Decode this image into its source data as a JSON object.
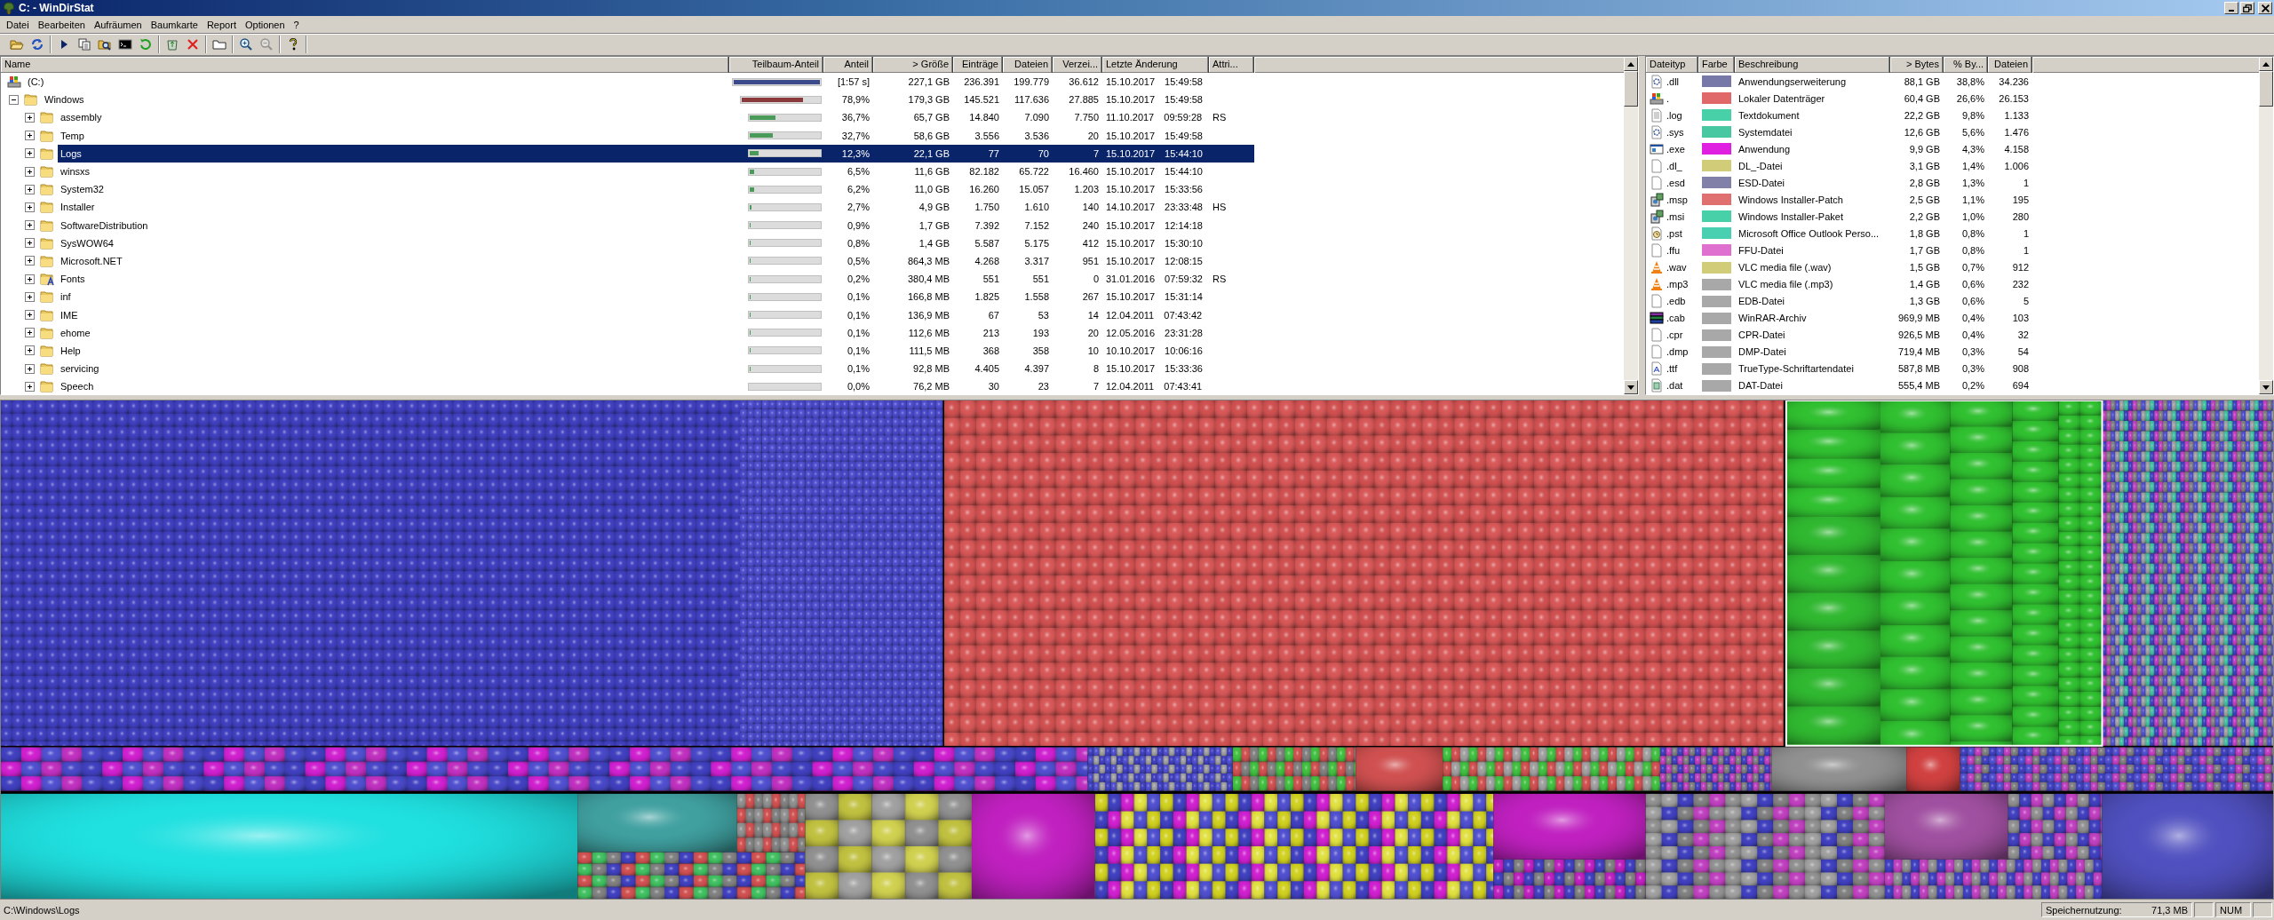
{
  "window": {
    "title": "C: - WinDirStat"
  },
  "menu": [
    "Datei",
    "Bearbeiten",
    "Aufräumen",
    "Baumkarte",
    "Report",
    "Optionen",
    "?"
  ],
  "toolbar": {
    "groups": [
      {
        "buttons": [
          {
            "kind": "open",
            "disabled": false
          },
          {
            "kind": "rescan",
            "disabled": false
          }
        ]
      },
      {
        "buttons": [
          {
            "kind": "play",
            "disabled": false
          },
          {
            "kind": "copy",
            "disabled": false
          },
          {
            "kind": "explorer",
            "disabled": false
          },
          {
            "kind": "terminal",
            "disabled": false
          },
          {
            "kind": "refresh",
            "disabled": false
          }
        ]
      },
      {
        "buttons": [
          {
            "kind": "recycle",
            "disabled": false
          },
          {
            "kind": "delete",
            "disabled": false
          }
        ]
      },
      {
        "buttons": [
          {
            "kind": "properties",
            "disabled": false
          }
        ]
      },
      {
        "buttons": [
          {
            "kind": "zoom_in",
            "disabled": false
          },
          {
            "kind": "zoom_out",
            "disabled": true
          }
        ]
      },
      {
        "buttons": [
          {
            "kind": "help",
            "disabled": false
          }
        ]
      }
    ]
  },
  "directory_tree": {
    "columns": [
      "Name",
      "Teilbaum-Anteil",
      "Anteil",
      "> Größe",
      "Einträge",
      "Dateien",
      "Verzei...",
      "Letzte Änderung",
      "Attri..."
    ],
    "rows": [
      {
        "name": "(C:)",
        "kind": "drive",
        "selected": false,
        "level": 1,
        "share": "[1:57 s]",
        "size": "227,1 GB",
        "entries": "236.391",
        "files": "199.779",
        "folders": "36.612",
        "modified": "15.10.2017 15:49:58",
        "children": [
          {
            "name": "Windows",
            "kind": "folder",
            "expanded": true,
            "selected": false,
            "level": 0.789,
            "share": "78,9%",
            "size": "179,3 GB",
            "entries": "145.521",
            "files": "117.636",
            "folders": "27.885",
            "modified": "15.10.2017 15:49:58",
            "children": [
              {
                "name": "assembly",
                "kind": "folder",
                "expanded": false,
                "selected": false,
                "level": 0.367,
                "share": "36,7%",
                "size": "65,7 GB",
                "entries": "14.840",
                "files": "7.090",
                "folders": "7.750",
                "modified": "11.10.2017 09:59:28",
                "attributes": "RS"
              },
              {
                "name": "Temp",
                "kind": "folder",
                "expanded": false,
                "selected": false,
                "level": 0.327,
                "share": "32,7%",
                "size": "58,6 GB",
                "entries": "3.556",
                "files": "3.536",
                "folders": "20",
                "modified": "15.10.2017 15:49:58"
              },
              {
                "name": "Logs",
                "kind": "folder",
                "expanded": false,
                "selected": true,
                "level": 0.123,
                "share": "12,3%",
                "size": "22,1 GB",
                "entries": "77",
                "files": "70",
                "folders": "7",
                "modified": "15.10.2017 15:44:10"
              },
              {
                "name": "winsxs",
                "kind": "folder",
                "expanded": false,
                "selected": false,
                "level": 0.065,
                "share": "6,5%",
                "size": "11,6 GB",
                "entries": "82.182",
                "files": "65.722",
                "folders": "16.460",
                "modified": "15.10.2017 15:44:10"
              },
              {
                "name": "System32",
                "kind": "folder",
                "expanded": false,
                "selected": false,
                "level": 0.062,
                "share": "6,2%",
                "size": "11,0 GB",
                "entries": "16.260",
                "files": "15.057",
                "folders": "1.203",
                "modified": "15.10.2017 15:33:56"
              },
              {
                "name": "Installer",
                "kind": "folder",
                "expanded": false,
                "selected": false,
                "level": 0.027,
                "share": "2,7%",
                "size": "4,9 GB",
                "entries": "1.750",
                "files": "1.610",
                "folders": "140",
                "modified": "14.10.2017 23:33:48",
                "attributes": "HS"
              },
              {
                "name": "SoftwareDistribution",
                "kind": "folder",
                "expanded": false,
                "selected": false,
                "level": 0.009,
                "share": "0,9%",
                "size": "1,7 GB",
                "entries": "7.392",
                "files": "7.152",
                "folders": "240",
                "modified": "15.10.2017 12:14:18"
              },
              {
                "name": "SysWOW64",
                "kind": "folder",
                "expanded": false,
                "selected": false,
                "level": 0.008,
                "share": "0,8%",
                "size": "1,4 GB",
                "entries": "5.587",
                "files": "5.175",
                "folders": "412",
                "modified": "15.10.2017 15:30:10"
              },
              {
                "name": "Microsoft.NET",
                "kind": "folder",
                "expanded": false,
                "selected": false,
                "level": 0.005,
                "share": "0,5%",
                "size": "864,3 MB",
                "entries": "4.268",
                "files": "3.317",
                "folders": "951",
                "modified": "15.10.2017 12:08:15"
              },
              {
                "name": "Fonts",
                "kind": "fonts_folder",
                "expanded": false,
                "selected": false,
                "level": 0.002,
                "share": "0,2%",
                "size": "380,4 MB",
                "entries": "551",
                "files": "551",
                "folders": "0",
                "modified": "31.01.2016 07:59:32",
                "attributes": "RS"
              },
              {
                "name": "inf",
                "kind": "folder",
                "expanded": false,
                "selected": false,
                "level": 0.001,
                "share": "0,1%",
                "size": "166,8 MB",
                "entries": "1.825",
                "files": "1.558",
                "folders": "267",
                "modified": "15.10.2017 15:31:14"
              },
              {
                "name": "IME",
                "kind": "folder",
                "expanded": false,
                "selected": false,
                "level": 0.001,
                "share": "0,1%",
                "size": "136,9 MB",
                "entries": "67",
                "files": "53",
                "folders": "14",
                "modified": "12.04.2011 07:43:42"
              },
              {
                "name": "ehome",
                "kind": "folder",
                "expanded": false,
                "selected": false,
                "level": 0.001,
                "share": "0,1%",
                "size": "112,6 MB",
                "entries": "213",
                "files": "193",
                "folders": "20",
                "modified": "12.05.2016 23:31:28"
              },
              {
                "name": "Help",
                "kind": "folder",
                "expanded": false,
                "selected": false,
                "level": 0.001,
                "share": "0,1%",
                "size": "111,5 MB",
                "entries": "368",
                "files": "358",
                "folders": "10",
                "modified": "10.10.2017 10:06:16"
              },
              {
                "name": "servicing",
                "kind": "folder",
                "expanded": false,
                "selected": false,
                "level": 0.001,
                "share": "0,1%",
                "size": "92,8 MB",
                "entries": "4.405",
                "files": "4.397",
                "folders": "8",
                "modified": "15.10.2017 15:33:36"
              },
              {
                "name": "Speech",
                "kind": "folder",
                "expanded": false,
                "selected": false,
                "level": 0,
                "share": "0,0%",
                "size": "76,2 MB",
                "entries": "30",
                "files": "23",
                "folders": "7",
                "modified": "12.04.2011 07:43:41"
              }
            ]
          }
        ]
      }
    ]
  },
  "file_types": {
    "columns": [
      "Dateityp",
      "Farbe",
      "Beschreibung",
      "> Bytes",
      "% By...",
      "Dateien"
    ],
    "rows": [
      {
        "ext": ".dll",
        "kind": "gear",
        "color": "#7878a8",
        "description": "Anwendungserweiterung",
        "bytes": "88,1 GB",
        "percent": "38,8%",
        "files": "34.236"
      },
      {
        "ext": ".",
        "kind": "drive",
        "color": "#e06868",
        "description": "Lokaler Datenträger",
        "bytes": "60,4 GB",
        "percent": "26,6%",
        "files": "26.153"
      },
      {
        "ext": ".log",
        "kind": "text",
        "color": "#48d0a8",
        "description": "Textdokument",
        "bytes": "22,2 GB",
        "percent": "9,8%",
        "files": "1.133"
      },
      {
        "ext": ".sys",
        "kind": "gear",
        "color": "#48c8a0",
        "description": "Systemdatei",
        "bytes": "12,6 GB",
        "percent": "5,6%",
        "files": "1.476"
      },
      {
        "ext": ".exe",
        "kind": "window",
        "color": "#e020e0",
        "description": "Anwendung",
        "bytes": "9,9 GB",
        "percent": "4,3%",
        "files": "4.158"
      },
      {
        "ext": ".dl_",
        "kind": "blank",
        "color": "#d0cc78",
        "description": "DL_-Datei",
        "bytes": "3,1 GB",
        "percent": "1,4%",
        "files": "1.006"
      },
      {
        "ext": ".esd",
        "kind": "blank",
        "color": "#8080a8",
        "description": "ESD-Datei",
        "bytes": "2,8 GB",
        "percent": "1,3%",
        "files": "1"
      },
      {
        "ext": ".msp",
        "kind": "installer",
        "color": "#e07070",
        "description": "Windows Installer-Patch",
        "bytes": "2,5 GB",
        "percent": "1,1%",
        "files": "195"
      },
      {
        "ext": ".msi",
        "kind": "installer",
        "color": "#48d0a8",
        "description": "Windows Installer-Paket",
        "bytes": "2,2 GB",
        "percent": "1,0%",
        "files": "280"
      },
      {
        "ext": ".pst",
        "kind": "outlook",
        "color": "#48d0b0",
        "description": "Microsoft Office Outlook Perso...",
        "bytes": "1,8 GB",
        "percent": "0,8%",
        "files": "1"
      },
      {
        "ext": ".ffu",
        "kind": "blank",
        "color": "#e070d0",
        "description": "FFU-Datei",
        "bytes": "1,7 GB",
        "percent": "0,8%",
        "files": "1"
      },
      {
        "ext": ".wav",
        "kind": "cone",
        "color": "#d0cc78",
        "description": "VLC media file (.wav)",
        "bytes": "1,5 GB",
        "percent": "0,7%",
        "files": "912"
      },
      {
        "ext": ".mp3",
        "kind": "cone",
        "color": "#a8a8a8",
        "description": "VLC media file (.mp3)",
        "bytes": "1,4 GB",
        "percent": "0,6%",
        "files": "232"
      },
      {
        "ext": ".edb",
        "kind": "blank",
        "color": "#a8a8a8",
        "description": "EDB-Datei",
        "bytes": "1,3 GB",
        "percent": "0,6%",
        "files": "5"
      },
      {
        "ext": ".cab",
        "kind": "books",
        "color": "#a8a8a8",
        "description": "WinRAR-Archiv",
        "bytes": "969,9 MB",
        "percent": "0,4%",
        "files": "103"
      },
      {
        "ext": ".cpr",
        "kind": "blank",
        "color": "#a8a8a8",
        "description": "CPR-Datei",
        "bytes": "926,5 MB",
        "percent": "0,4%",
        "files": "32"
      },
      {
        "ext": ".dmp",
        "kind": "blank",
        "color": "#a8a8a8",
        "description": "DMP-Datei",
        "bytes": "719,4 MB",
        "percent": "0,3%",
        "files": "54"
      },
      {
        "ext": ".ttf",
        "kind": "font",
        "color": "#a8a8a8",
        "description": "TrueType-Schriftartendatei",
        "bytes": "587,8 MB",
        "percent": "0,3%",
        "files": "908"
      },
      {
        "ext": ".dat",
        "kind": "data",
        "color": "#a8a8a8",
        "description": "DAT-Datei",
        "bytes": "555,4 MB",
        "percent": "0,2%",
        "files": "694"
      }
    ]
  },
  "status_bar": {
    "path": "C:\\Windows\\Logs",
    "memory_label": "Speichernutzung:",
    "memory_value": "71,3 MB",
    "num_indicator": "NUM"
  }
}
